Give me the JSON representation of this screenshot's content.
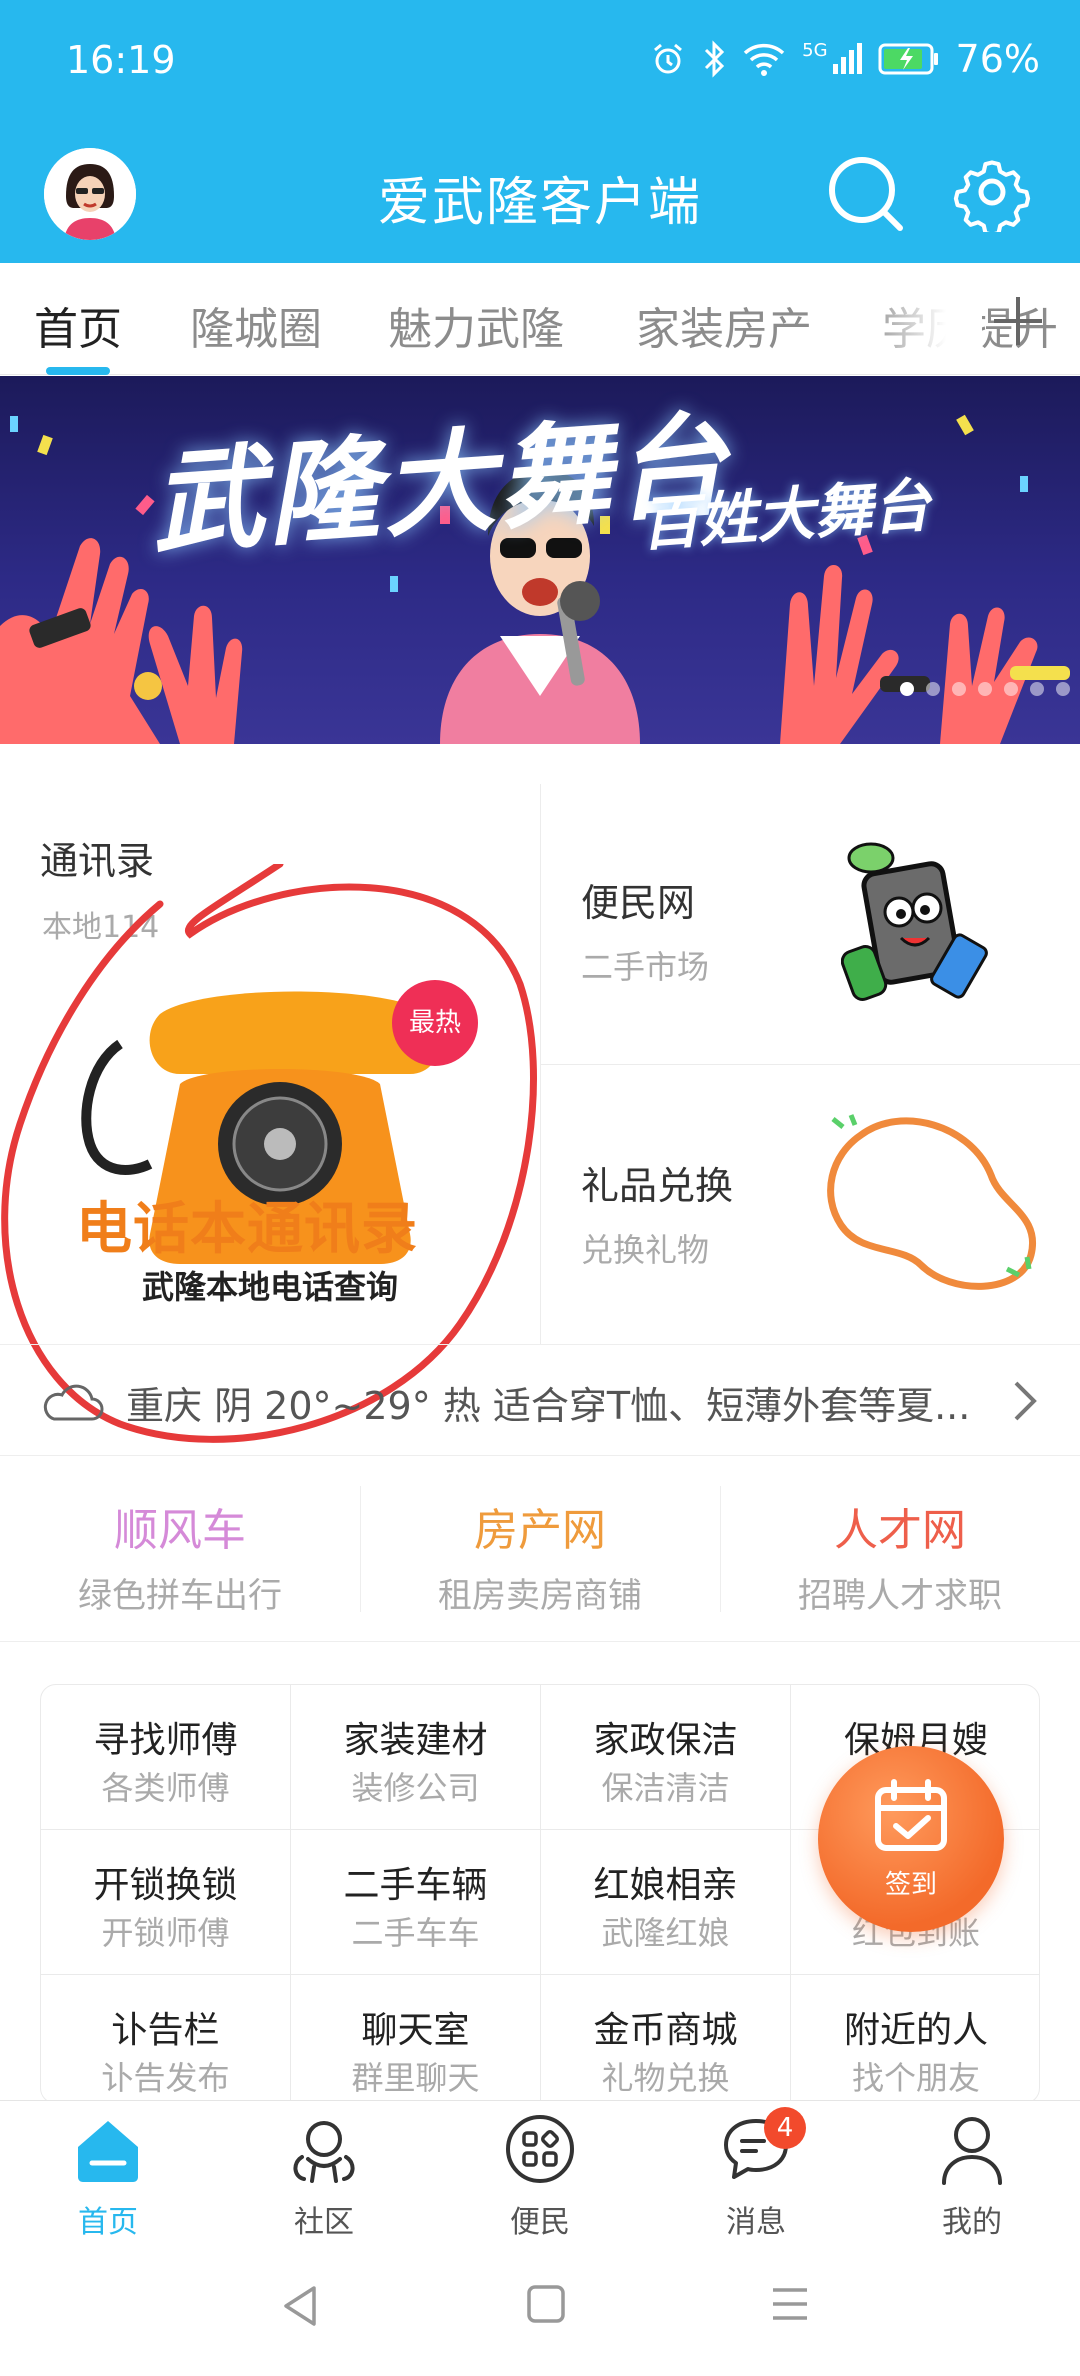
{
  "status_bar": {
    "time": "16:19",
    "network": "5G",
    "battery": "76%"
  },
  "header": {
    "title": "爱武隆客户端"
  },
  "tabs": [
    {
      "label": "首页",
      "active": true
    },
    {
      "label": "隆城圈"
    },
    {
      "label": "魅力武隆"
    },
    {
      "label": "家装房产"
    },
    {
      "label": "学历提升"
    }
  ],
  "banner": {
    "title": "武隆大舞台",
    "subtitle": "百姓大舞台"
  },
  "features": {
    "left": {
      "title": "通讯录",
      "subtitle": "本地114",
      "ad_title": "电话本通讯录",
      "ad_subtitle": "武隆本地电话查询",
      "badge": "最热"
    },
    "right_top": {
      "title": "便民网",
      "subtitle": "二手市场"
    },
    "right_bottom": {
      "title": "礼品兑换",
      "subtitle": "兑换礼物"
    }
  },
  "weather": {
    "text": "重庆 阴 20°~29° 热 适合穿T恤、短薄外套等夏..."
  },
  "tri": [
    {
      "title": "顺风车",
      "subtitle": "绿色拼车出行",
      "color": "#d58ad8"
    },
    {
      "title": "房产网",
      "subtitle": "租房卖房商铺",
      "color": "#ef9b3c"
    },
    {
      "title": "人才网",
      "subtitle": "招聘人才求职",
      "color": "#ee5f4b"
    }
  ],
  "grid": [
    {
      "title": "寻找师傅",
      "subtitle": "各类师傅"
    },
    {
      "title": "家装建材",
      "subtitle": "装修公司"
    },
    {
      "title": "家政保洁",
      "subtitle": "保洁清洁"
    },
    {
      "title": "保姆月嫂",
      "subtitle": ""
    },
    {
      "title": "开锁换锁",
      "subtitle": "开锁师傅"
    },
    {
      "title": "二手车辆",
      "subtitle": "二手车车"
    },
    {
      "title": "红娘相亲",
      "subtitle": "武隆红娘"
    },
    {
      "title": "",
      "subtitle": "红包到账"
    },
    {
      "title": "讣告栏",
      "subtitle": "讣告发布"
    },
    {
      "title": "聊天室",
      "subtitle": "群里聊天"
    },
    {
      "title": "金币商城",
      "subtitle": "礼物兑换"
    },
    {
      "title": "附近的人",
      "subtitle": "找个朋友"
    }
  ],
  "signin": {
    "label": "签到"
  },
  "bottom_nav": [
    {
      "label": "首页",
      "icon": "home-icon",
      "active": true
    },
    {
      "label": "社区",
      "icon": "community-icon"
    },
    {
      "label": "便民",
      "icon": "apps-icon"
    },
    {
      "label": "消息",
      "icon": "message-icon",
      "badge": "4"
    },
    {
      "label": "我的",
      "icon": "profile-icon"
    }
  ],
  "colors": {
    "primary": "#27b8ee",
    "hot_badge": "#ef2f56",
    "signin": "#f36a2a"
  }
}
